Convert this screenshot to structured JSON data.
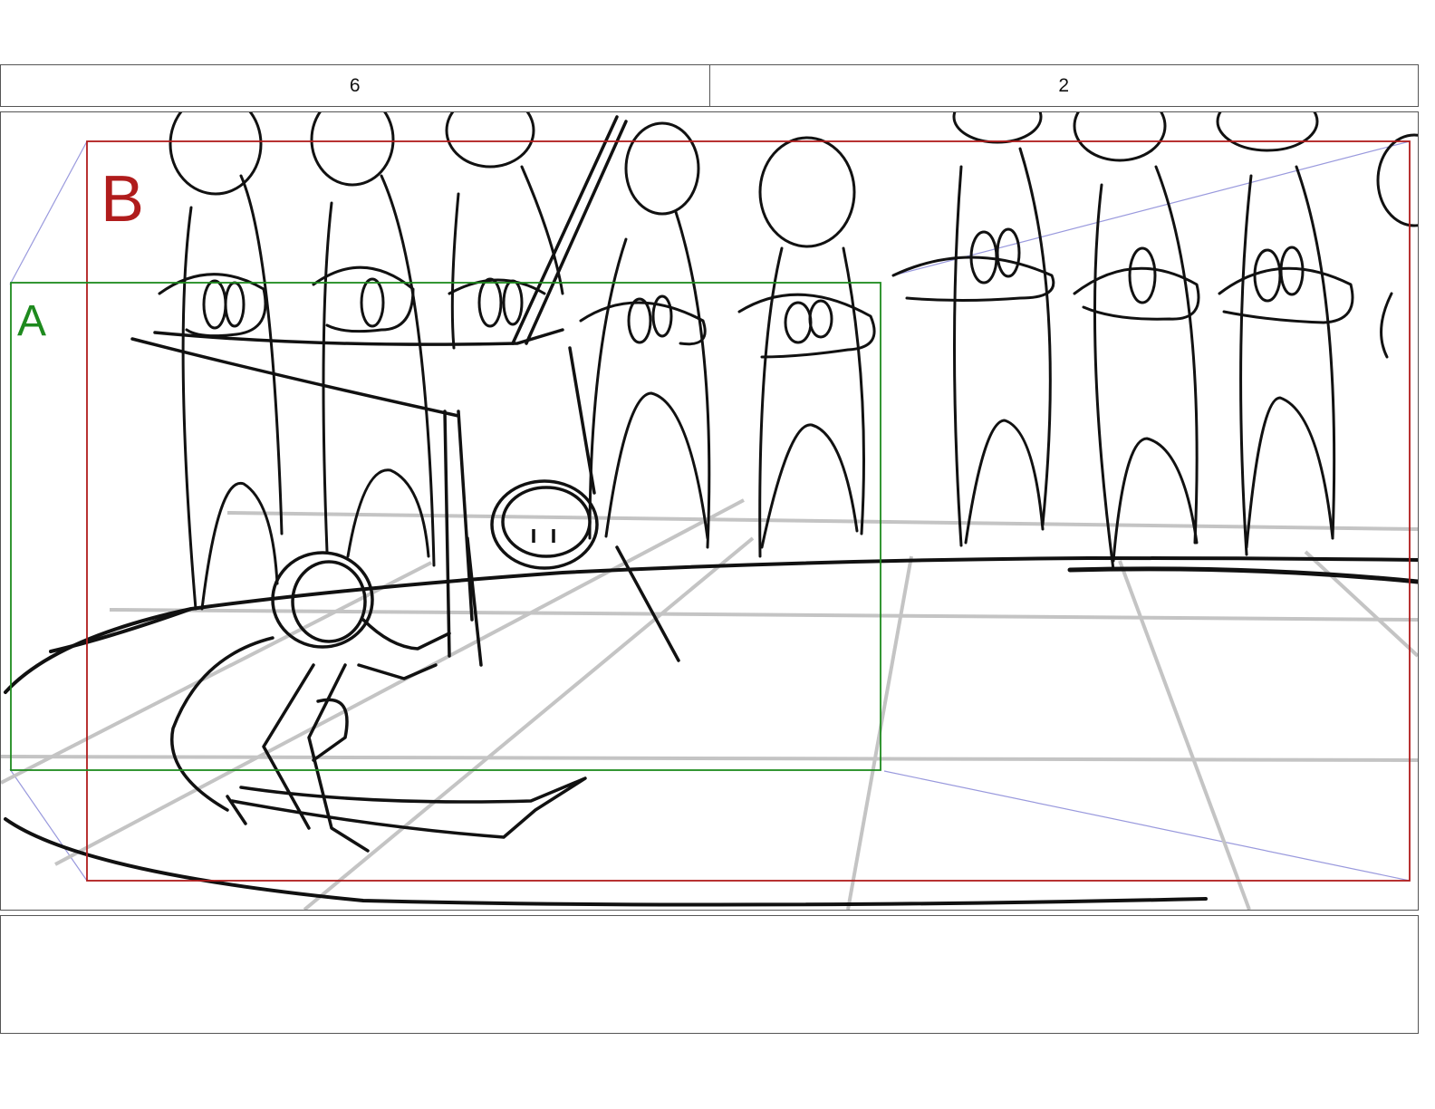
{
  "header": {
    "scene_number": "6",
    "panel_number": "2"
  },
  "panel": {
    "frames": [
      {
        "label": "A",
        "color": "#1e8a1e"
      },
      {
        "label": "B",
        "color": "#b01c1c"
      }
    ],
    "guide_color": "#9999dd",
    "grid_color": "#c4c4c4",
    "ink_color": "#111111"
  },
  "notes": {
    "text": ""
  }
}
